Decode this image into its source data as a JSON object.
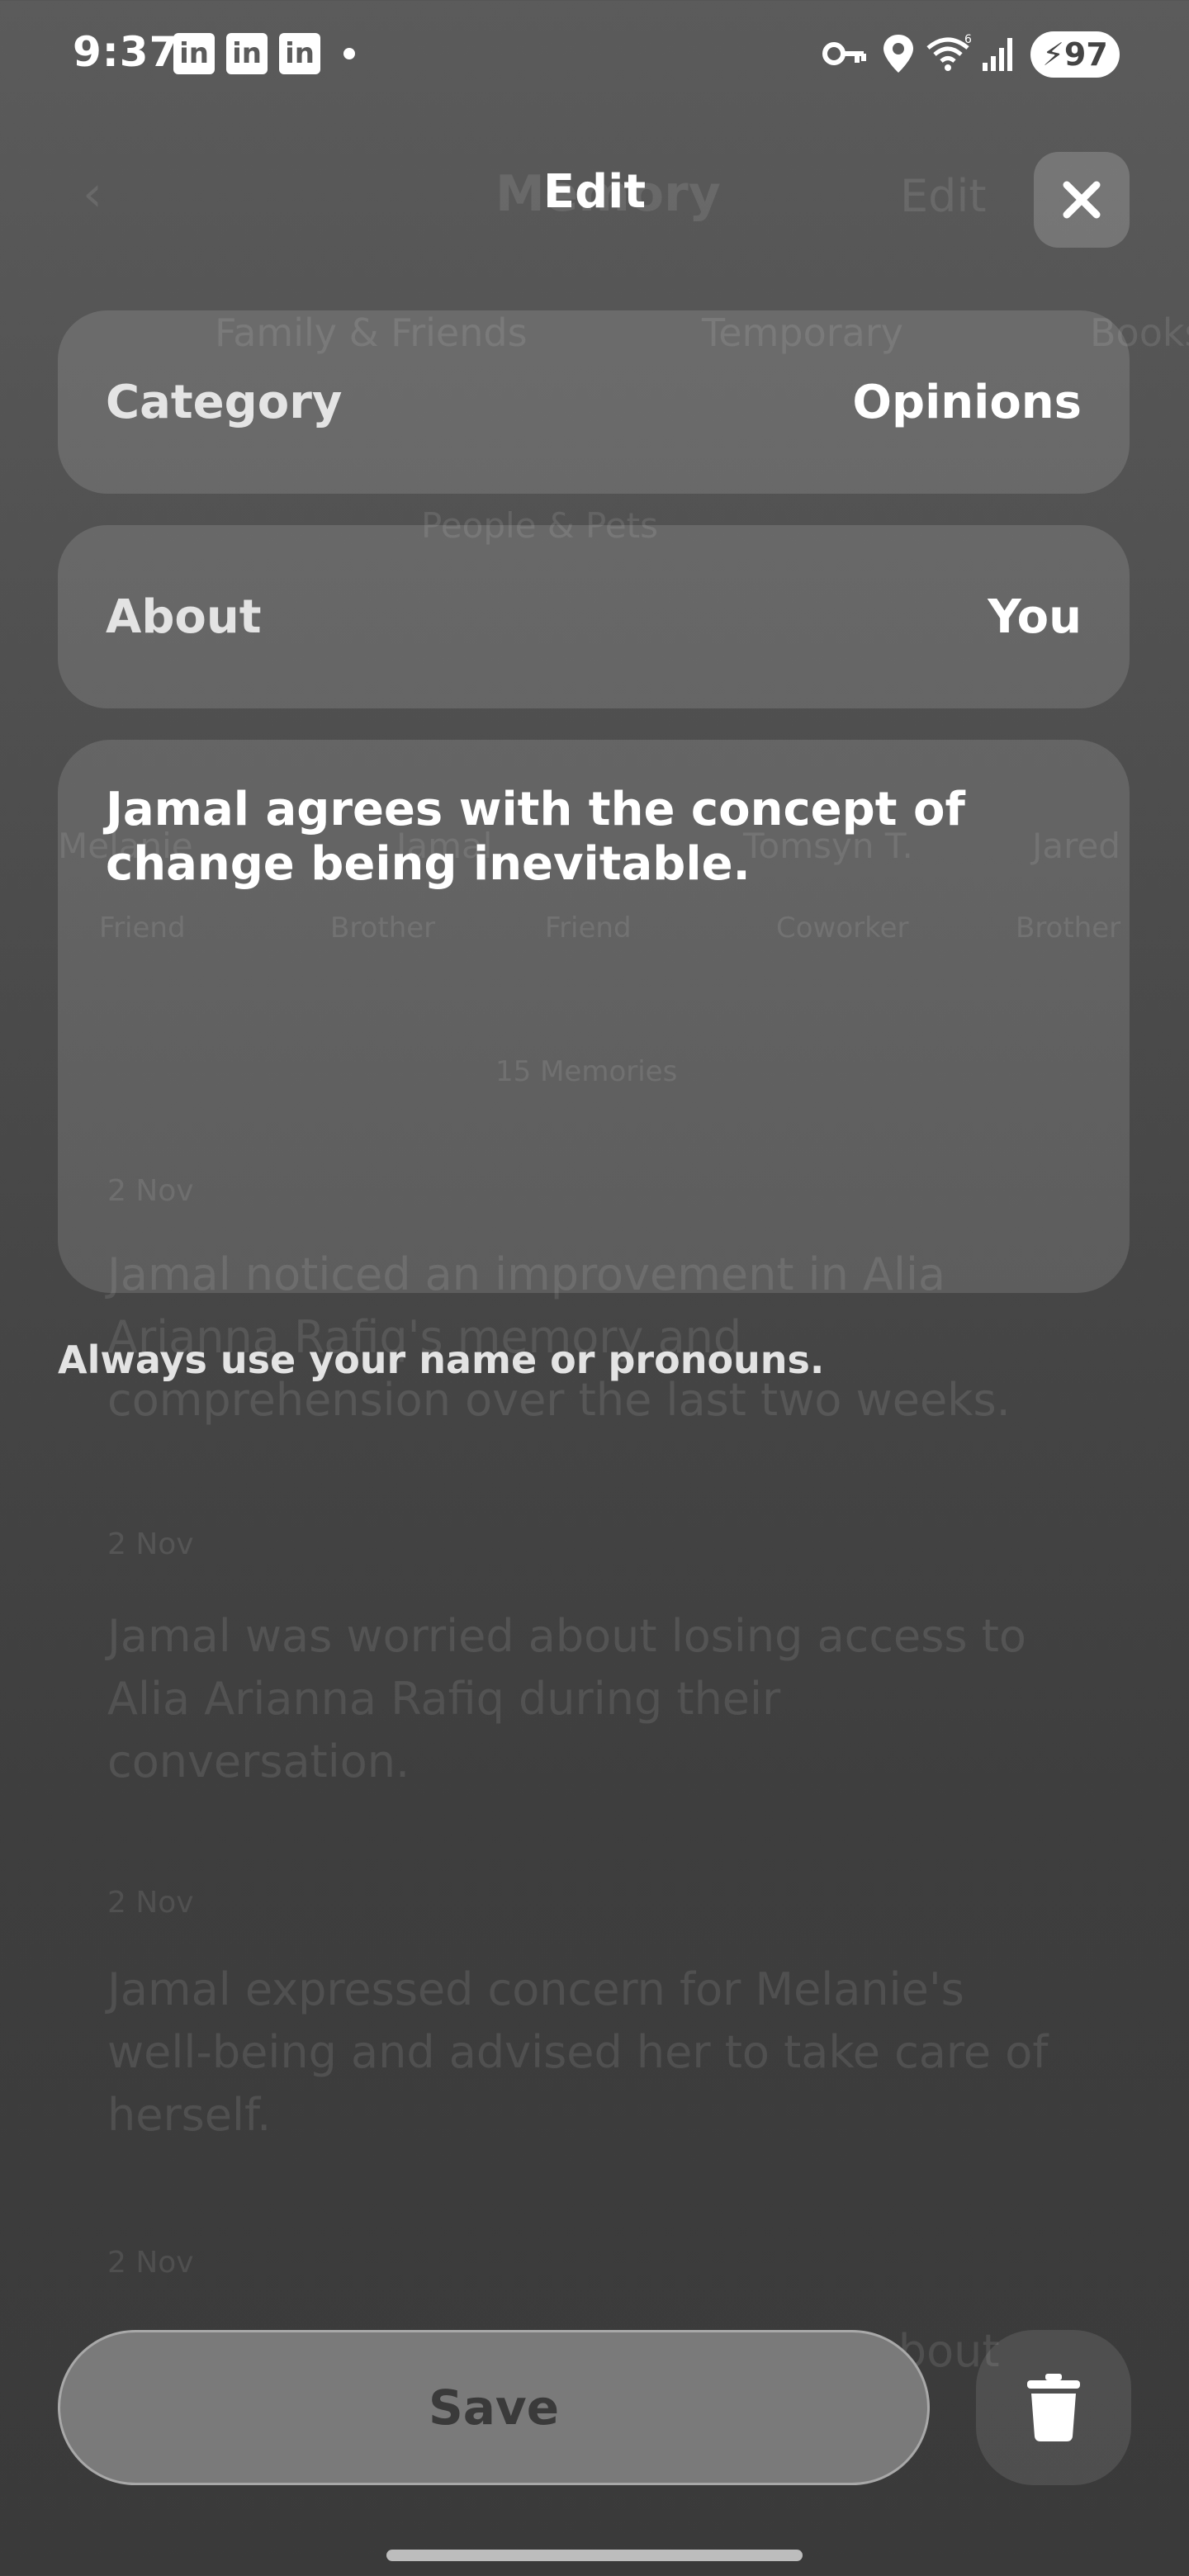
{
  "status_bar": {
    "time": "9:37",
    "notif_icons": [
      "in",
      "in",
      "in"
    ],
    "battery": "97"
  },
  "background": {
    "header_title": "Memory",
    "header_edit": "Edit",
    "filters": [
      "Family & Friends",
      "Temporary",
      "Books"
    ],
    "section_label": "People & Pets",
    "people": [
      "Melanie",
      "Jamal",
      "Tomsyn T.",
      "Jared"
    ],
    "people_sub": [
      "Friend",
      "Brother",
      "Friend",
      "Coworker",
      "Brother"
    ],
    "count_label": "15 Memories",
    "entries": [
      {
        "meta": "2 Nov",
        "text": "Jamal noticed an improvement in Alia Arianna Rafiq's memory and comprehension over the last two weeks."
      },
      {
        "meta": "2 Nov",
        "text": "Jamal was worried about losing access to Alia Arianna Rafiq during their conversation."
      },
      {
        "meta": "2 Nov",
        "text": "Jamal expressed concern for Melanie's well-being and advised her to take care of herself."
      },
      {
        "meta": "2 Nov",
        "text": "Jamal informed Alia Arianna Rafiq about Melanie's sickness and injury."
      }
    ]
  },
  "modal": {
    "title": "Edit",
    "category_label": "Category",
    "category_value": "Opinions",
    "about_label": "About",
    "about_value": "You",
    "memory_text": "Jamal agrees with the concept of change being inevitable.",
    "hint": "Always use your name or pronouns.",
    "save_label": "Save"
  }
}
